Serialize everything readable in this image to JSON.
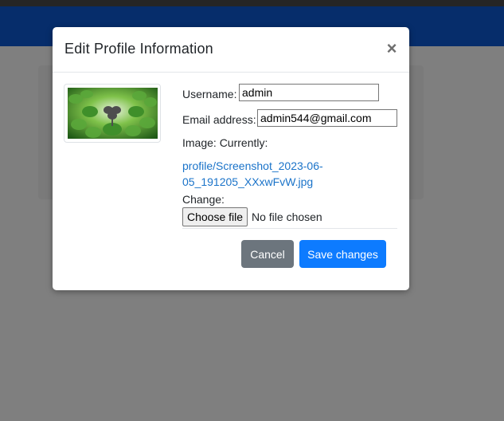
{
  "modal": {
    "title": "Edit Profile Information",
    "close_label": "×"
  },
  "form": {
    "username_label": "Username:",
    "username_value": "admin",
    "email_label": "Email address:",
    "email_value": "admin544@gmail.com",
    "image_label": "Image: Currently:",
    "current_file_line1": "profile/Screenshot_2023-06-",
    "current_file_line2": "05_191205_XXxwFvW.jpg",
    "change_label": "Change:",
    "choose_file_label": "Choose file",
    "no_file_text": "No file chosen"
  },
  "buttons": {
    "cancel_label": "Cancel",
    "save_label": "Save changes"
  },
  "colors": {
    "navbar": "#0d5bd7",
    "primary": "#0d7bff",
    "secondary": "#6c757d",
    "link": "#1a73c9"
  },
  "icons": {
    "close": "close-icon",
    "profile_image": "profile-thumbnail-image"
  }
}
